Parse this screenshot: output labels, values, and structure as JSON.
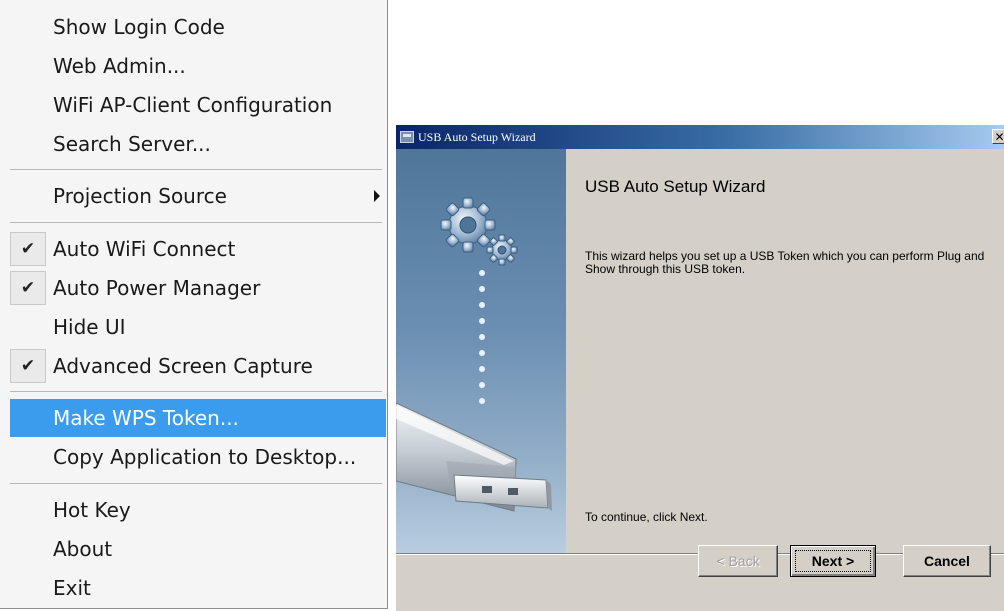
{
  "menu": {
    "items": [
      {
        "label": "Show Login Code"
      },
      {
        "label": "Web Admin..."
      },
      {
        "label": "WiFi AP-Client Configuration"
      },
      {
        "label": "Search Server..."
      },
      {
        "label": "Projection Source",
        "submenu": true
      },
      {
        "label": "Auto WiFi Connect",
        "checked": true
      },
      {
        "label": "Auto Power Manager",
        "checked": true
      },
      {
        "label": "Hide UI"
      },
      {
        "label": "Advanced Screen Capture",
        "checked": true
      },
      {
        "label": "Make WPS Token...",
        "highlighted": true
      },
      {
        "label": "Copy Application to Desktop..."
      },
      {
        "label": "Hot Key"
      },
      {
        "label": "About"
      },
      {
        "label": "Exit"
      }
    ],
    "check_glyph": "✔",
    "highlight_color": "#3b9cee"
  },
  "wizard": {
    "title": "USB Auto Setup Wizard",
    "close_glyph": "✕",
    "heading": "USB Auto Setup Wizard",
    "description": "This wizard helps you set up a USB Token which you can perform Plug and Show through this USB token.",
    "continue_text": "To continue, click Next.",
    "buttons": {
      "back": "< Back",
      "next": "Next >",
      "cancel": "Cancel"
    },
    "side_icons": [
      "gears-icon",
      "usb-drive-icon"
    ]
  }
}
